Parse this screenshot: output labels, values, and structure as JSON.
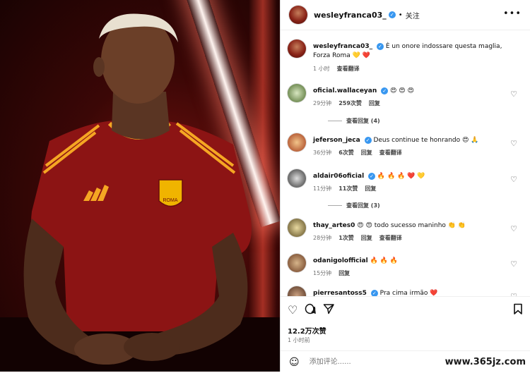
{
  "post": {
    "username": "wesleyfranca03_",
    "follow_label": "关注",
    "more_icon": "more-horizontal-icon",
    "caption": "È un onore indossare questa maglia, Forza Roma 💛 ❤️",
    "caption_time": "1 小时",
    "caption_translate": "查看翻译",
    "likes": "12.2万次赞",
    "time": "1 小时前",
    "add_comment_placeholder": "添加评论......",
    "watermark": "www.365jz.com"
  },
  "photo": {
    "crest_text": "ROMA"
  },
  "comments": [
    {
      "user": "oficial.wallaceyan",
      "text": "😍 😍 😍",
      "time": "29分钟",
      "likes": "259次赞",
      "reply": "回复",
      "view_replies": "查看回复 (4)"
    },
    {
      "user": "jeferson_jeca",
      "text": "Deus continue te honrando 😍 🙏",
      "time": "36分钟",
      "likes": "6次赞",
      "reply": "回复",
      "translate": "查看翻译"
    },
    {
      "user": "aldair06oficial",
      "text": "🔥 🔥 🔥 ❤️ 💛",
      "time": "11分钟",
      "likes": "11次赞",
      "reply": "回复",
      "view_replies": "查看回复 (3)"
    },
    {
      "user": "thay_artes0",
      "text": "😍 😍 todo sucesso maninho 👏 👏",
      "time": "28分钟",
      "likes": "1次赞",
      "reply": "回复",
      "translate": "查看翻译"
    },
    {
      "user": "odanigolofficial",
      "text": "🔥 🔥 🔥",
      "time": "15分钟",
      "reply": "回复"
    },
    {
      "user": "pierresantoss5",
      "text": "Pra cima irmão ❤️"
    }
  ],
  "icons": {
    "like": "heart-icon",
    "comment": "comment-icon",
    "share": "send-icon",
    "save": "bookmark-icon",
    "emoji": "emoji-icon"
  },
  "colors": {
    "verified": "#3897f0",
    "jersey": "#8c1414",
    "accent": "#f5a623"
  }
}
